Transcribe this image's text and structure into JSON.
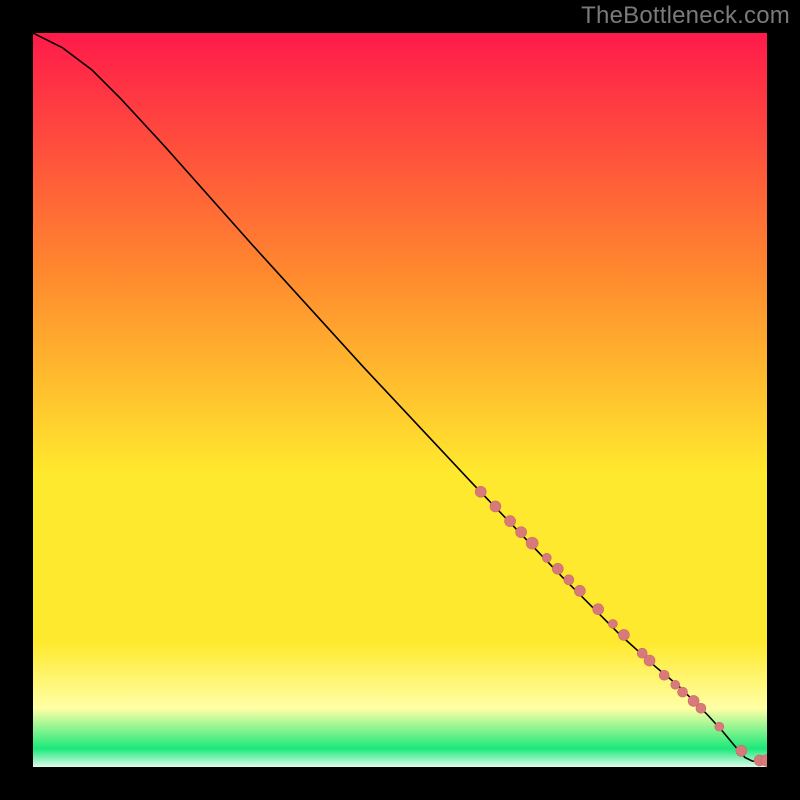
{
  "attribution": "TheBottleneck.com",
  "colors": {
    "gradient_top": "#ff1a4a",
    "gradient_orange": "#ff8a2e",
    "gradient_yellow": "#ffe92e",
    "gradient_pale": "#ffffa6",
    "gradient_green": "#1be97a",
    "gradient_bottom": "#e0faea",
    "line": "#000000",
    "point_fill": "#d87a7a",
    "point_stroke": "#c86a6a",
    "frame": "#000000"
  },
  "chart_data": {
    "type": "line",
    "title": "",
    "xlabel": "",
    "ylabel": "",
    "xlim": [
      0,
      100
    ],
    "ylim": [
      0,
      100
    ],
    "series": [
      {
        "name": "curve",
        "x": [
          0,
          4,
          8,
          12,
          18,
          30,
          45,
          60,
          72,
          80,
          85,
          88,
          90,
          92,
          94,
          95.5,
          97,
          98,
          99,
          100
        ],
        "y": [
          100,
          98,
          95,
          91,
          84.5,
          71,
          54.5,
          38.5,
          26,
          18,
          13.5,
          11,
          9,
          7,
          4.8,
          3,
          1.3,
          0.8,
          0.8,
          0.8
        ]
      }
    ],
    "points": {
      "name": "markers",
      "x": [
        61,
        63,
        65,
        66.5,
        68,
        70,
        71.5,
        73,
        74.5,
        77,
        79,
        80.5,
        83,
        84,
        86,
        87.5,
        88.5,
        90,
        91,
        93.5,
        96.5,
        99,
        100
      ],
      "y": [
        37.5,
        35.5,
        33.5,
        32,
        30.5,
        28.5,
        27,
        25.5,
        24,
        21.5,
        19.5,
        18,
        15.5,
        14.5,
        12.5,
        11.2,
        10.2,
        9,
        8,
        5.5,
        2.2,
        0.9,
        0.9
      ],
      "r": [
        5.5,
        5.5,
        5.5,
        5.5,
        6,
        4.5,
        5.5,
        5,
        5.5,
        5.5,
        4.5,
        5.5,
        5,
        5.5,
        5,
        4.5,
        5,
        5.5,
        5,
        4.5,
        5.5,
        5.5,
        6
      ]
    }
  }
}
